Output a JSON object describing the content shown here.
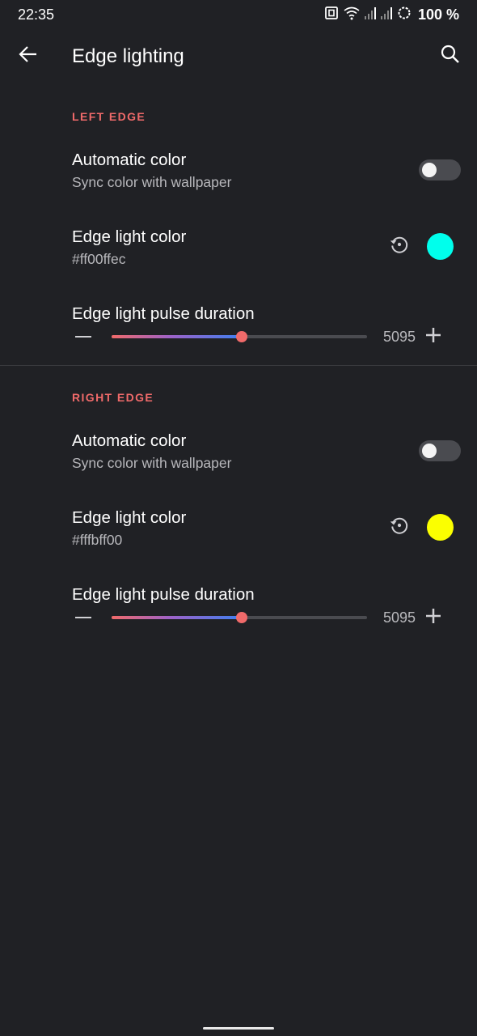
{
  "status_bar": {
    "time": "22:35",
    "battery": "100 %",
    "icons": [
      "nfc-icon",
      "wifi-icon",
      "signal-icon",
      "signal-icon",
      "battery-saver-icon"
    ]
  },
  "app_bar": {
    "title": "Edge lighting",
    "back_icon": "arrow-back-icon",
    "search_icon": "search-icon"
  },
  "sections": [
    {
      "header": "LEFT EDGE",
      "auto_color": {
        "title": "Automatic color",
        "summary": "Sync color with wallpaper",
        "enabled": false
      },
      "edge_color": {
        "title": "Edge light color",
        "summary": "#ff00ffec",
        "swatch": "#00ffec",
        "reset_icon": "reset-icon"
      },
      "pulse": {
        "title": "Edge light pulse duration",
        "value": "5095",
        "fraction": 0.51
      }
    },
    {
      "header": "RIGHT EDGE",
      "auto_color": {
        "title": "Automatic color",
        "summary": "Sync color with wallpaper",
        "enabled": false
      },
      "edge_color": {
        "title": "Edge light color",
        "summary": "#fffbff00",
        "swatch": "#fbff00",
        "reset_icon": "reset-icon"
      },
      "pulse": {
        "title": "Edge light pulse duration",
        "value": "5095",
        "fraction": 0.51
      }
    }
  ],
  "colors": {
    "accent": "#f06a6a",
    "background": "#202125",
    "toggle_off": "#4a4b50"
  }
}
